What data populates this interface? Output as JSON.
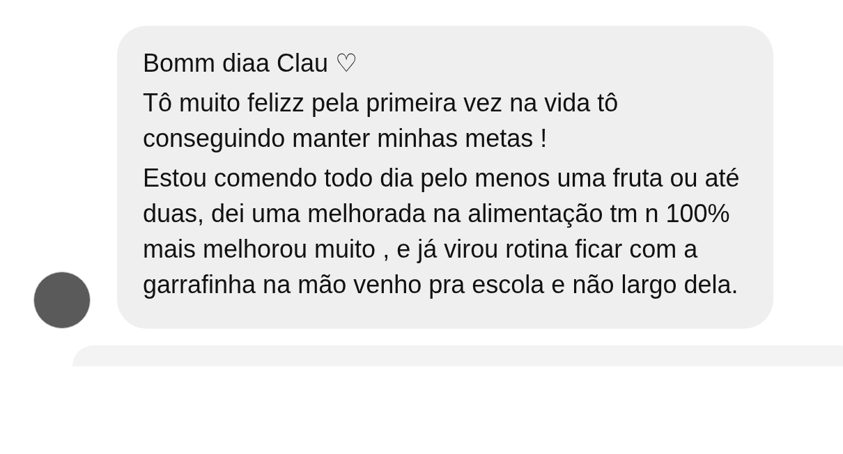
{
  "message": {
    "paragraphs": [
      "Bomm diaa Clau ♡",
      "Tô muito felizz pela primeira vez na vida tô conseguindo manter minhas metas !",
      "Estou comendo todo dia pelo menos uma fruta ou até duas, dei uma melhorada na alimentação tm n 100% mais melhorou muito , e já virou rotina ficar com a garrafinha na mão venho pra escola e não largo dela."
    ]
  }
}
